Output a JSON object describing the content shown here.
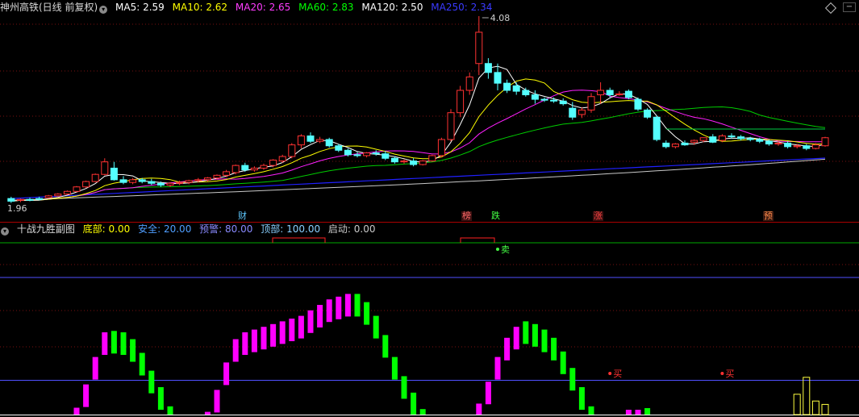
{
  "stock_header": {
    "name": "神州高铁(日线 前复权)",
    "ma5": {
      "label": "MA5:",
      "value": "2.59",
      "color": "#ffffff"
    },
    "ma10": {
      "label": "MA10:",
      "value": "2.62",
      "color": "#ffff00"
    },
    "ma20": {
      "label": "MA20:",
      "value": "2.65",
      "color": "#ff00ff"
    },
    "ma60": {
      "label": "MA60:",
      "value": "2.83",
      "color": "#00ff00"
    },
    "ma120": {
      "label": "MA120:",
      "value": "2.50",
      "color": "#ffffff"
    },
    "ma250": {
      "label": "MA250:",
      "value": "2.34",
      "color": "#3a3aff"
    }
  },
  "price_labels": {
    "high": "4.08",
    "low": "1.96"
  },
  "event_markers": [
    {
      "label": "财",
      "color": "#5fc8ff",
      "bg": "#000000"
    },
    {
      "label": "榜",
      "color": "#ff6a6a",
      "bg": "#3a1010"
    },
    {
      "label": "跌",
      "color": "#44ff44",
      "bg": "#000000"
    },
    {
      "label": "涨",
      "color": "#ff4444",
      "bg": "#3a1010"
    },
    {
      "label": "预",
      "color": "#ff8a4a",
      "bg": "#3a1a10"
    }
  ],
  "indicator_header": {
    "name": "十战九胜副图",
    "bottom": {
      "label": "底部:",
      "value": "0.00"
    },
    "safe": {
      "label": "安全:",
      "value": "20.00"
    },
    "warn": {
      "label": "预警:",
      "value": "80.00"
    },
    "top": {
      "label": "顶部:",
      "value": "100.00"
    },
    "start": {
      "label": "启动:",
      "value": "0.00"
    }
  },
  "signals": {
    "sell": "卖",
    "buy": "买"
  },
  "colors": {
    "up": "#ff3232",
    "down": "#54ffff",
    "divider": "#aa0000",
    "grid": "#7a1010",
    "rise_bar": "#ff00ff",
    "fall_bar": "#00ff00"
  },
  "chart_data": {
    "type": "candlestick",
    "ylim": [
      1.96,
      4.08
    ],
    "candles": [
      [
        2.04,
        2.06,
        2.01,
        1.99
      ],
      [
        2.02,
        2.04,
        2.03,
        2.0
      ],
      [
        2.03,
        2.05,
        2.02,
        2.01
      ],
      [
        2.04,
        2.06,
        2.03,
        2.02
      ],
      [
        2.05,
        2.08,
        2.07,
        2.04
      ],
      [
        2.07,
        2.1,
        2.09,
        2.06
      ],
      [
        2.09,
        2.13,
        2.12,
        2.08
      ],
      [
        2.12,
        2.18,
        2.17,
        2.11
      ],
      [
        2.17,
        2.24,
        2.23,
        2.16
      ],
      [
        2.23,
        2.32,
        2.31,
        2.22
      ],
      [
        2.31,
        2.49,
        2.45,
        2.3
      ],
      [
        2.38,
        2.45,
        2.25,
        2.24
      ],
      [
        2.25,
        2.29,
        2.22,
        2.2
      ],
      [
        2.22,
        2.27,
        2.25,
        2.2
      ],
      [
        2.25,
        2.27,
        2.23,
        2.21
      ],
      [
        2.23,
        2.26,
        2.21,
        2.19
      ],
      [
        2.21,
        2.23,
        2.19,
        2.17
      ],
      [
        2.19,
        2.22,
        2.21,
        2.17
      ],
      [
        2.21,
        2.24,
        2.22,
        2.19
      ],
      [
        2.22,
        2.25,
        2.24,
        2.2
      ],
      [
        2.24,
        2.27,
        2.25,
        2.22
      ],
      [
        2.25,
        2.28,
        2.27,
        2.23
      ],
      [
        2.27,
        2.31,
        2.3,
        2.25
      ],
      [
        2.3,
        2.36,
        2.34,
        2.28
      ],
      [
        2.33,
        2.42,
        2.41,
        2.31
      ],
      [
        2.41,
        2.44,
        2.36,
        2.34
      ],
      [
        2.36,
        2.4,
        2.38,
        2.34
      ],
      [
        2.38,
        2.43,
        2.41,
        2.36
      ],
      [
        2.41,
        2.48,
        2.47,
        2.39
      ],
      [
        2.46,
        2.53,
        2.51,
        2.44
      ],
      [
        2.51,
        2.66,
        2.64,
        2.49
      ],
      [
        2.64,
        2.76,
        2.74,
        2.6
      ],
      [
        2.74,
        2.78,
        2.68,
        2.66
      ],
      [
        2.68,
        2.73,
        2.7,
        2.66
      ],
      [
        2.7,
        2.72,
        2.63,
        2.61
      ],
      [
        2.63,
        2.65,
        2.58,
        2.56
      ],
      [
        2.58,
        2.6,
        2.53,
        2.51
      ],
      [
        2.53,
        2.56,
        2.52,
        2.5
      ],
      [
        2.52,
        2.56,
        2.55,
        2.5
      ],
      [
        2.55,
        2.58,
        2.54,
        2.52
      ],
      [
        2.54,
        2.57,
        2.49,
        2.47
      ],
      [
        2.49,
        2.51,
        2.45,
        2.43
      ],
      [
        2.45,
        2.48,
        2.46,
        2.43
      ],
      [
        2.46,
        2.49,
        2.42,
        2.4
      ],
      [
        2.42,
        2.47,
        2.46,
        2.41
      ],
      [
        2.46,
        2.53,
        2.52,
        2.45
      ],
      [
        2.52,
        2.72,
        2.7,
        2.5
      ],
      [
        2.7,
        3.04,
        3.0,
        2.68
      ],
      [
        3.0,
        3.3,
        3.25,
        2.95
      ],
      [
        3.25,
        3.45,
        3.4,
        3.2
      ],
      [
        3.55,
        4.08,
        3.9,
        3.42
      ],
      [
        3.55,
        3.61,
        3.45,
        3.38
      ],
      [
        3.45,
        3.55,
        3.33,
        3.25
      ],
      [
        3.33,
        3.37,
        3.25,
        3.22
      ],
      [
        3.3,
        3.34,
        3.24,
        3.2
      ],
      [
        3.25,
        3.28,
        3.2,
        3.18
      ],
      [
        3.2,
        3.25,
        3.15,
        3.1
      ],
      [
        3.15,
        3.17,
        3.14,
        3.12
      ],
      [
        3.14,
        3.17,
        3.13,
        3.11
      ],
      [
        3.13,
        3.16,
        3.1,
        3.08
      ],
      [
        3.05,
        3.12,
        2.95,
        2.92
      ],
      [
        2.98,
        3.06,
        3.03,
        2.94
      ],
      [
        3.03,
        3.22,
        3.18,
        3.0
      ],
      [
        3.2,
        3.34,
        3.25,
        3.1
      ],
      [
        3.25,
        3.28,
        3.2,
        3.17
      ],
      [
        3.2,
        3.24,
        3.21,
        3.19
      ],
      [
        3.24,
        3.26,
        3.17,
        3.15
      ],
      [
        3.15,
        3.17,
        3.04,
        3.02
      ],
      [
        3.03,
        3.05,
        2.95,
        2.93
      ],
      [
        2.95,
        2.97,
        2.7,
        2.68
      ],
      [
        2.66,
        2.69,
        2.62,
        2.6
      ],
      [
        2.62,
        2.66,
        2.65,
        2.6
      ],
      [
        2.66,
        2.69,
        2.64,
        2.63
      ],
      [
        2.67,
        2.7,
        2.69,
        2.64
      ],
      [
        2.69,
        2.72,
        2.72,
        2.67
      ],
      [
        2.73,
        2.76,
        2.67,
        2.66
      ],
      [
        2.69,
        2.76,
        2.74,
        2.67
      ],
      [
        2.74,
        2.77,
        2.73,
        2.71
      ],
      [
        2.73,
        2.75,
        2.71,
        2.69
      ],
      [
        2.71,
        2.73,
        2.7,
        2.68
      ],
      [
        2.7,
        2.72,
        2.68,
        2.66
      ],
      [
        2.68,
        2.7,
        2.65,
        2.63
      ],
      [
        2.65,
        2.68,
        2.66,
        2.63
      ],
      [
        2.66,
        2.68,
        2.62,
        2.6
      ],
      [
        2.62,
        2.65,
        2.63,
        2.6
      ],
      [
        2.63,
        2.65,
        2.6,
        2.58
      ],
      [
        2.6,
        2.66,
        2.64,
        2.59
      ],
      [
        2.63,
        2.73,
        2.72,
        2.62
      ]
    ],
    "ma_series": [
      {
        "name": "MA5"
      },
      {
        "name": "MA10"
      },
      {
        "name": "MA20"
      },
      {
        "name": "MA60"
      },
      {
        "name": "MA120"
      },
      {
        "name": "MA250"
      }
    ],
    "indicator": {
      "ylim": [
        0,
        100
      ],
      "levels": [
        0,
        20,
        80,
        100
      ],
      "bars": [
        0,
        0,
        0,
        0,
        0,
        0,
        0,
        5,
        22,
        42,
        60,
        61,
        60,
        55,
        45,
        32,
        20,
        6,
        0,
        0,
        0,
        2,
        18,
        38,
        55,
        60,
        62,
        64,
        66,
        68,
        70,
        72,
        76,
        80,
        84,
        86,
        88,
        88,
        82,
        72,
        58,
        42,
        28,
        16,
        4,
        0,
        0,
        0,
        0,
        0,
        8,
        24,
        42,
        56,
        64,
        68,
        66,
        62,
        56,
        46,
        34,
        20,
        6,
        0,
        0,
        0,
        0,
        0,
        0,
        0,
        0,
        0,
        0,
        0,
        0,
        0,
        0,
        0,
        0,
        0,
        0,
        0,
        0,
        0,
        0,
        0,
        0,
        0
      ],
      "bar_dir": [
        1,
        1,
        1,
        1,
        1,
        1,
        1,
        1,
        1,
        1,
        1,
        0,
        0,
        0,
        0,
        0,
        0,
        0,
        0,
        0,
        0,
        1,
        1,
        1,
        1,
        1,
        1,
        1,
        1,
        1,
        1,
        1,
        1,
        1,
        1,
        1,
        1,
        0,
        0,
        0,
        0,
        0,
        0,
        0,
        0,
        0,
        0,
        0,
        0,
        0,
        1,
        1,
        1,
        1,
        1,
        0,
        0,
        0,
        0,
        0,
        0,
        0,
        0,
        0,
        0,
        0,
        0,
        0,
        0,
        0,
        0,
        0,
        0,
        0,
        0,
        0,
        0,
        0,
        0,
        0,
        0,
        0,
        0,
        0,
        0,
        0,
        0,
        0
      ],
      "small_bars": [
        6,
        6,
        8,
        0
      ],
      "yellow_bars": [
        12,
        22,
        8,
        6
      ]
    }
  }
}
